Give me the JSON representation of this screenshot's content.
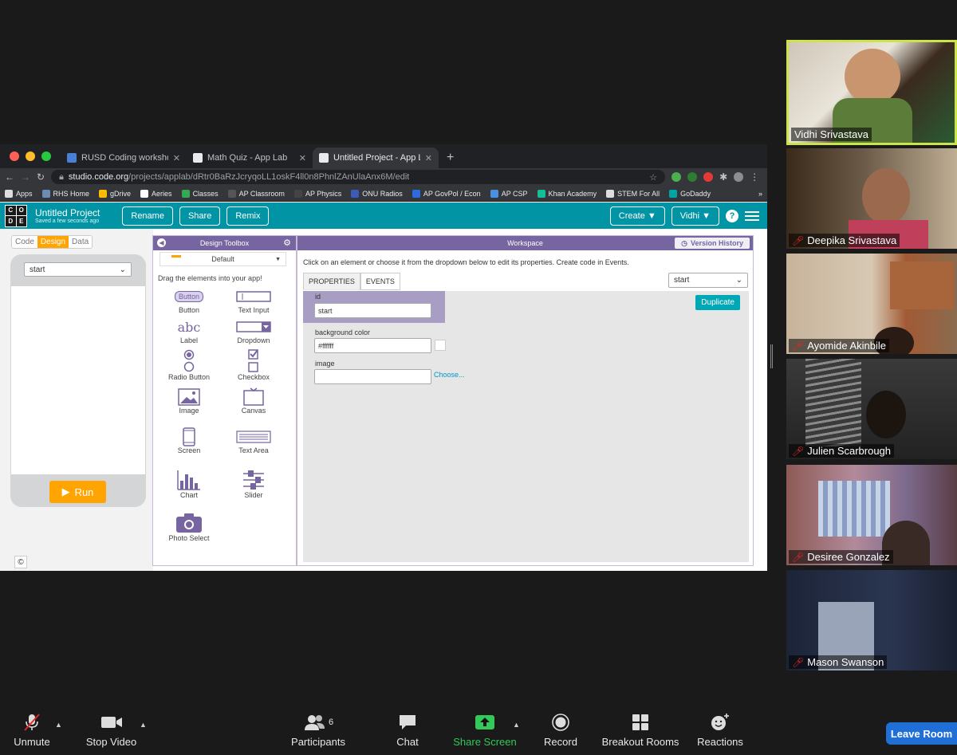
{
  "browser": {
    "tabs": [
      {
        "title": "RUSD Coding workshop - Goo"
      },
      {
        "title": "Math Quiz - App Lab"
      },
      {
        "title": "Untitled Project - App Lab"
      }
    ],
    "url_host": "studio.code.org",
    "url_path": "/projects/applab/dRtr0BaRzJcryqoLL1oskF4ll0n8PhnlZAnUlaAnx6M/edit",
    "bookmarks": [
      "Apps",
      "RHS Home",
      "gDrive",
      "Aeries",
      "Classes",
      "AP Classroom",
      "AP Physics",
      "ONU Radios",
      "AP GovPol / Econ",
      "AP CSP",
      "Khan Academy",
      "STEM For All",
      "GoDaddy"
    ]
  },
  "app": {
    "logo_letters": [
      "C",
      "O",
      "D",
      "E"
    ],
    "project_title": "Untitled Project",
    "saved_status": "Saved a few seconds ago",
    "buttons": {
      "rename": "Rename",
      "share": "Share",
      "remix": "Remix",
      "create": "Create",
      "user": "Vidhi"
    },
    "help_glyph": "?",
    "modes": {
      "code": "Code",
      "design": "Design",
      "data": "Data"
    },
    "screen_select": "start",
    "run_label": "Run",
    "copyright": "©"
  },
  "toolbox": {
    "title": "Design Toolbox",
    "theme": "Default",
    "hint": "Drag the elements into your app!",
    "items": [
      {
        "label": "Button",
        "icon": "button-icon",
        "inner": "Button"
      },
      {
        "label": "Text Input",
        "icon": "text-input-icon"
      },
      {
        "label": "Label",
        "icon": "label-icon",
        "inner": "abc"
      },
      {
        "label": "Dropdown",
        "icon": "dropdown-icon"
      },
      {
        "label": "Radio Button",
        "icon": "radio-icon"
      },
      {
        "label": "Checkbox",
        "icon": "checkbox-icon"
      },
      {
        "label": "Image",
        "icon": "image-icon"
      },
      {
        "label": "Canvas",
        "icon": "canvas-icon"
      },
      {
        "label": "Screen",
        "icon": "screen-icon"
      },
      {
        "label": "Text Area",
        "icon": "text-area-icon"
      },
      {
        "label": "Chart",
        "icon": "chart-icon"
      },
      {
        "label": "Slider",
        "icon": "slider-icon"
      },
      {
        "label": "Photo Select",
        "icon": "camera-icon"
      }
    ]
  },
  "workspace": {
    "title": "Workspace",
    "version_history": "Version History",
    "hint": "Click on an element or choose it from the dropdown below to edit its properties. Create code in Events.",
    "tabs": [
      "PROPERTIES",
      "EVENTS"
    ],
    "element_select": "start",
    "duplicate": "Duplicate",
    "props": {
      "id_label": "id",
      "id_value": "start",
      "bg_label": "background color",
      "bg_value": "#ffffff",
      "image_label": "image",
      "image_value": "",
      "choose": "Choose..."
    }
  },
  "participants": [
    {
      "name": "Vidhi Srivastava",
      "muted": false,
      "active": true
    },
    {
      "name": "Deepika Srivastava",
      "muted": true
    },
    {
      "name": "Ayomide Akinbile",
      "muted": true
    },
    {
      "name": "Julien Scarbrough",
      "muted": true
    },
    {
      "name": "Desiree Gonzalez",
      "muted": true
    },
    {
      "name": "Mason Swanson",
      "muted": true
    }
  ],
  "zoom_toolbar": {
    "unmute": "Unmute",
    "stop_video": "Stop Video",
    "participants": "Participants",
    "participant_count": "6",
    "chat": "Chat",
    "share_screen": "Share Screen",
    "record": "Record",
    "breakout_rooms": "Breakout Rooms",
    "reactions": "Reactions",
    "leave_room": "Leave Room"
  },
  "colors": {
    "codeorg_teal": "#0094a5",
    "toolbox_purple": "#7665a0",
    "run_orange": "#ffa400",
    "zoom_green": "#34c759",
    "leave_blue": "#1f6fd6",
    "active_speaker": "#cde34a"
  }
}
